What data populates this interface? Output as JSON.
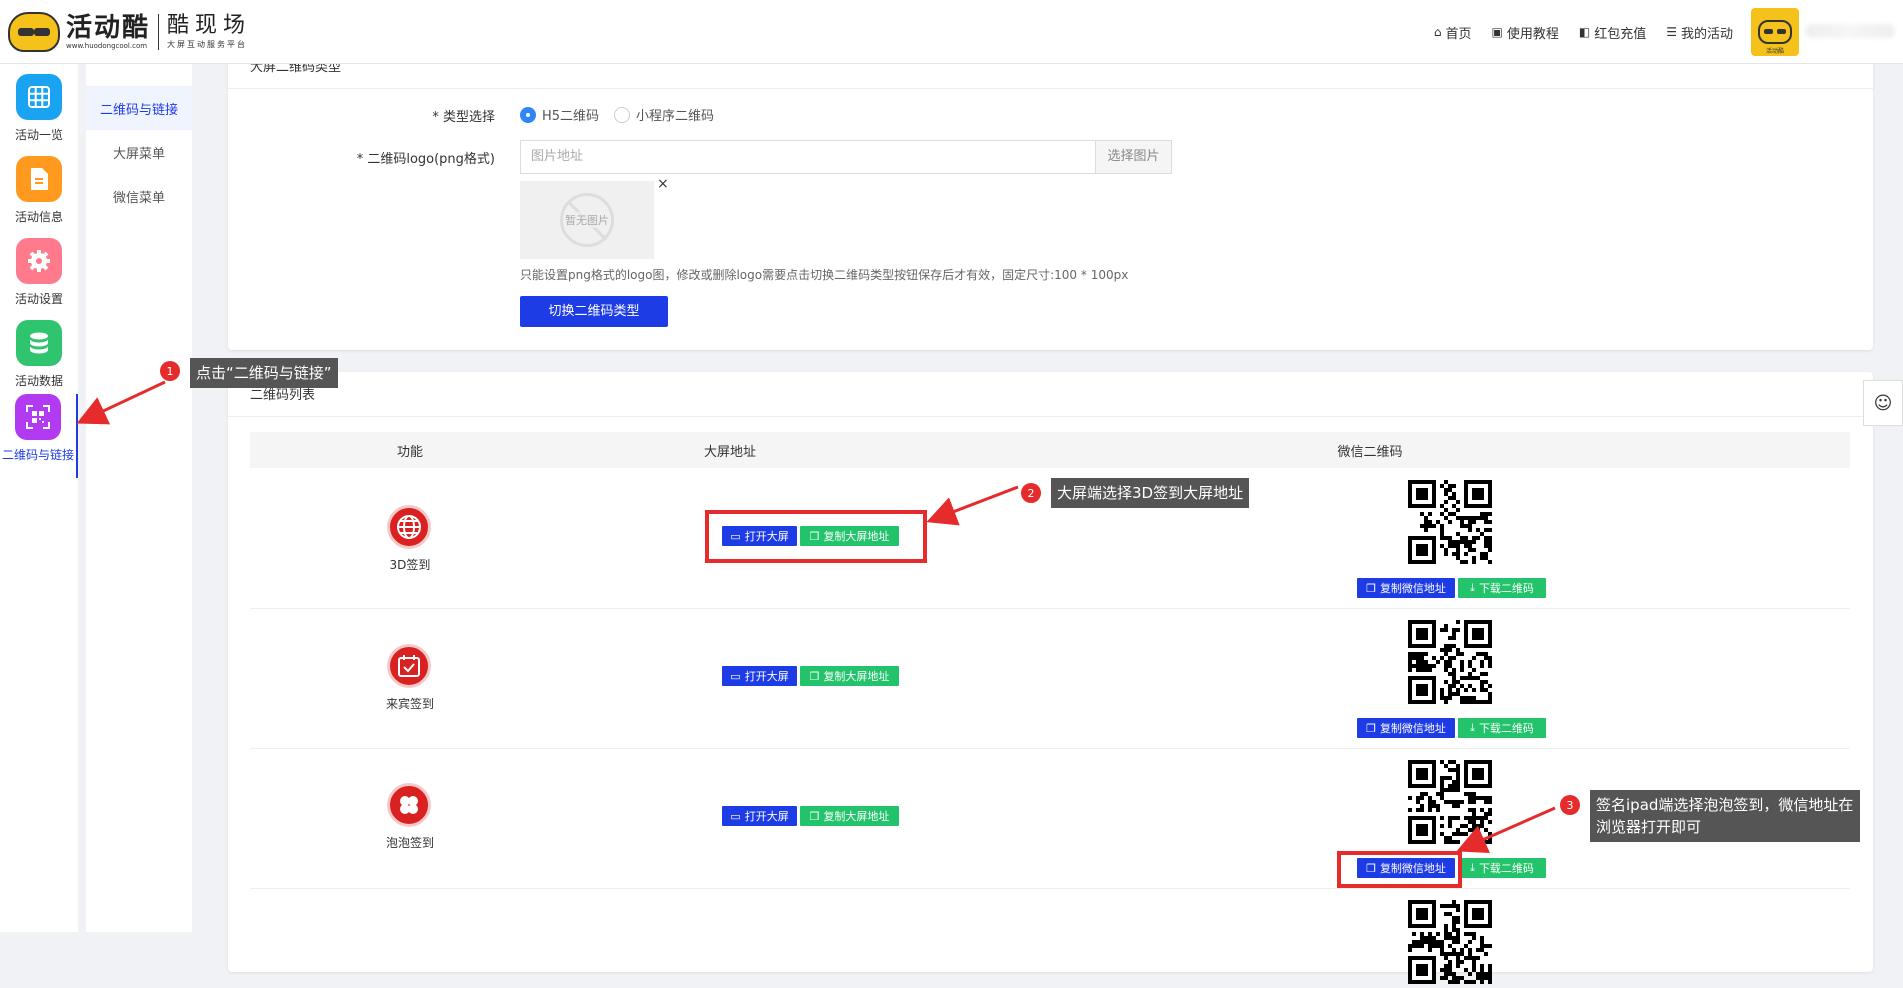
{
  "header": {
    "logo_main": "活动酷",
    "logo_url": "www.huodongcool.com",
    "logo_sub_main": "酷现场",
    "logo_sub_small": "大屏互动服务平台",
    "nav": [
      {
        "label": "首页",
        "icon": "home-icon"
      },
      {
        "label": "使用教程",
        "icon": "book-icon"
      },
      {
        "label": "红包充值",
        "icon": "wallet-icon"
      },
      {
        "label": "我的活动",
        "icon": "list-icon"
      }
    ],
    "avatar_caption": "活动酷"
  },
  "sidebar": {
    "items": [
      {
        "label": "活动一览",
        "icon": "grid-icon",
        "color": "#1aa3f0"
      },
      {
        "label": "活动信息",
        "icon": "document-icon",
        "color": "#ff9a1f"
      },
      {
        "label": "活动设置",
        "icon": "gear-icon",
        "color": "#ff7a8c"
      },
      {
        "label": "活动数据",
        "icon": "database-icon",
        "color": "#2fc46e"
      },
      {
        "label": "二维码与链接",
        "icon": "qrcode-icon",
        "color": "#b23af0",
        "active": true
      }
    ]
  },
  "submenu": {
    "items": [
      {
        "label": "二维码与链接",
        "active": true
      },
      {
        "label": "大屏菜单"
      },
      {
        "label": "微信菜单"
      }
    ]
  },
  "qr_type_card": {
    "title": "大屏二维码类型",
    "type_label": "* 类型选择",
    "type_options": [
      "H5二维码",
      "小程序二维码"
    ],
    "logo_label": "* 二维码logo(png格式)",
    "image_placeholder": "图片地址",
    "choose_image_button": "选择图片",
    "no_image_text": "暂无图片",
    "close_symbol": "×",
    "hint": "只能设置png格式的logo图，修改或删除logo需要点击切换二维码类型按钮保存后才有效，固定尺寸:100 * 100px",
    "switch_button": "切换二维码类型"
  },
  "qr_list_card": {
    "title": "二维码列表",
    "columns": [
      "功能",
      "大屏地址",
      "微信二维码"
    ],
    "rows": [
      {
        "name": "3D签到",
        "icon": "globe-icon"
      },
      {
        "name": "来宾签到",
        "icon": "calendar-check-icon"
      },
      {
        "name": "泡泡签到",
        "icon": "bubbles-icon"
      }
    ],
    "open_screen_button": "打开大屏",
    "copy_screen_button": "复制大屏地址",
    "copy_wechat_button": "复制微信地址",
    "download_qr_button": "下载二维码"
  },
  "annotations": [
    {
      "number": "1",
      "text": "点击“二维码与链接”"
    },
    {
      "number": "2",
      "text": "大屏端选择3D签到大屏地址"
    },
    {
      "number": "3",
      "text": "签名ipad端选择泡泡签到，微信地址在浏览器打开即可"
    }
  ],
  "colors": {
    "primary": "#1e3ce6",
    "green": "#23c36b",
    "annotation_red": "#e52b2b"
  }
}
